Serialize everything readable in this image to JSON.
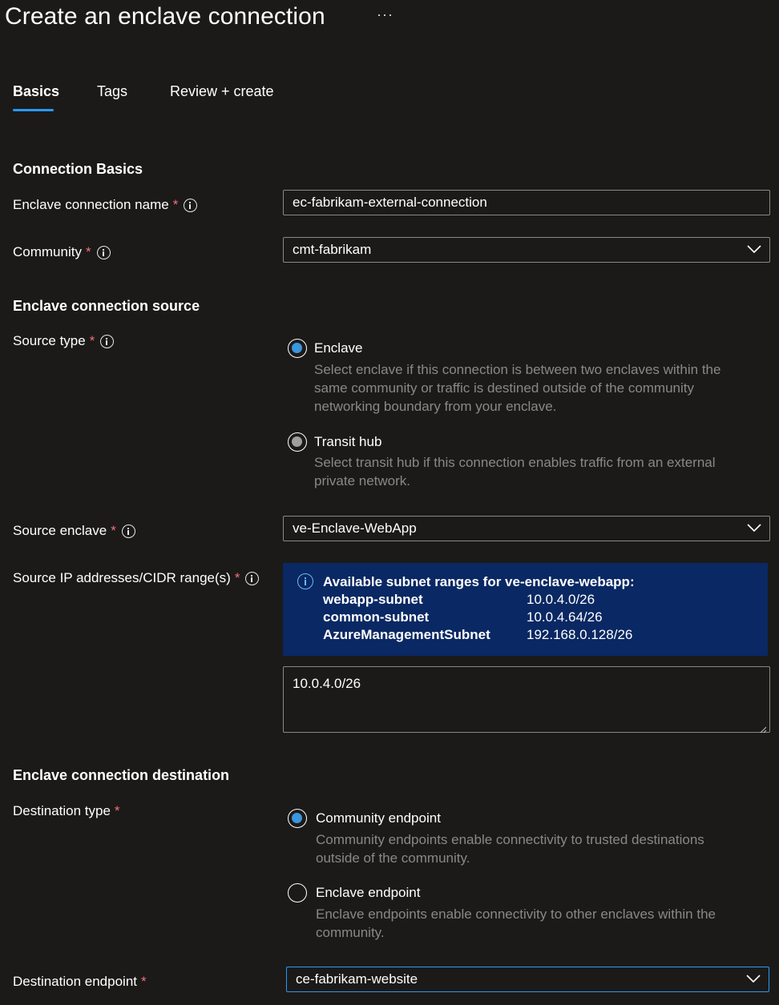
{
  "header": {
    "title": "Create an enclave connection",
    "more_label": "···"
  },
  "tabs": [
    {
      "label": "Basics",
      "active": true
    },
    {
      "label": "Tags",
      "active": false
    },
    {
      "label": "Review + create",
      "active": false
    }
  ],
  "sections": {
    "basics": "Connection Basics",
    "source": "Enclave connection source",
    "destination": "Enclave connection destination"
  },
  "fields": {
    "connection_name": {
      "label": "Enclave connection name",
      "required": "*",
      "value": "ec-fabrikam-external-connection"
    },
    "community": {
      "label": "Community",
      "required": "*",
      "value": "cmt-fabrikam"
    },
    "source_type": {
      "label": "Source type",
      "required": "*"
    },
    "source_enclave": {
      "label": "Source enclave",
      "required": "*",
      "value": "ve-Enclave-WebApp"
    },
    "source_ip": {
      "label": "Source IP addresses/CIDR range(s)",
      "required": "*",
      "value": "10.0.4.0/26"
    },
    "destination_type": {
      "label": "Destination type",
      "required": "*"
    },
    "destination_endpoint": {
      "label": "Destination endpoint",
      "required": "*",
      "value": "ce-fabrikam-website"
    }
  },
  "source_type_options": [
    {
      "label": "Enclave",
      "selected": true,
      "description": "Select enclave if this connection is between two enclaves within the same community or traffic is destined outside of the community networking boundary from your enclave."
    },
    {
      "label": "Transit hub",
      "selected": false,
      "description": "Select transit hub if this connection enables traffic from an external private network."
    }
  ],
  "destination_type_options": [
    {
      "label": "Community endpoint",
      "selected": true,
      "description": "Community endpoints enable connectivity to trusted destinations outside of the community."
    },
    {
      "label": "Enclave endpoint",
      "selected": false,
      "description": "Enclave endpoints enable connectivity to other enclaves within the community."
    }
  ],
  "subnet_info": {
    "title": "Available subnet ranges for ve-enclave-webapp:",
    "rows": [
      {
        "name": "webapp-subnet",
        "range": "10.0.4.0/26"
      },
      {
        "name": "common-subnet",
        "range": "10.0.4.64/26"
      },
      {
        "name": "AzureManagementSubnet",
        "range": "192.168.0.128/26"
      }
    ]
  },
  "colors": {
    "background": "#1b1a19",
    "accent": "#2899f5",
    "radio_checked": "#3a96dd",
    "info_box": "#0a2863",
    "required": "#f1707b",
    "muted_text": "#8a8886"
  }
}
